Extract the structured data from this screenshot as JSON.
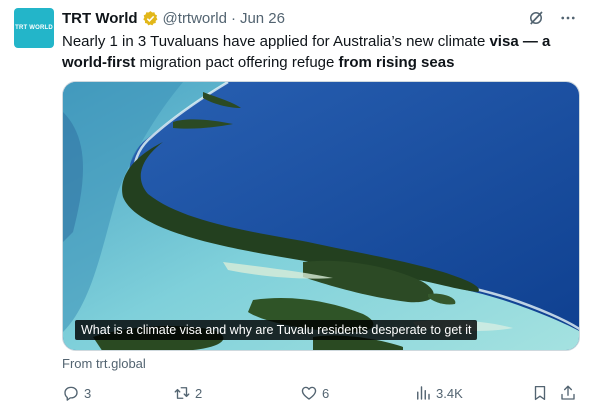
{
  "avatar": {
    "text": "TRT WORLD",
    "bg": "#23b5c9"
  },
  "header": {
    "name": "TRT World",
    "handle": "@trtworld",
    "separator": "·",
    "date": "Jun 26"
  },
  "tweet": {
    "t1": "Nearly 1 in 3 Tuvaluans have applied for Australia’s new climate ",
    "b1": "visa — a world-first",
    "t2": " migration pact offering refuge ",
    "b2": "from rising seas"
  },
  "media": {
    "caption": "What is a climate visa and why are Tuvalu residents desperate to get it"
  },
  "source": "From trt.global",
  "actions": {
    "replies": "3",
    "reposts": "2",
    "likes": "6",
    "views": "3.4K"
  },
  "icons": [
    "verified-badge-icon",
    "grok-icon",
    "more-icon",
    "reply-icon",
    "repost-icon",
    "like-icon",
    "views-icon",
    "bookmark-icon",
    "share-icon"
  ],
  "colors": {
    "accent": "#1d9bf0",
    "muted": "#536471",
    "gold": "#e2b719"
  }
}
